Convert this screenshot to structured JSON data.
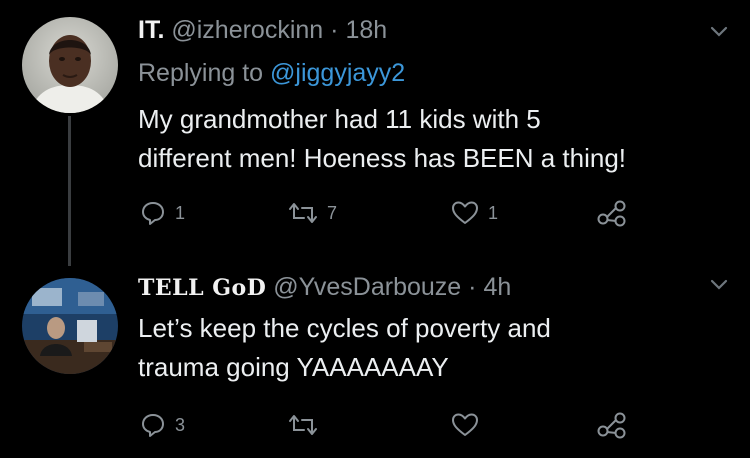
{
  "tweets": [
    {
      "display_name": "IT.",
      "handle": "@izherockinn",
      "separator": "·",
      "time": "18h",
      "reply_prefix": "Replying to",
      "reply_to": "@jiggyjayy2",
      "body_lines": [
        "My grandmother had 11 kids with 5",
        "different men! Hoeness has BEEN a thing!"
      ],
      "replies": "1",
      "retweets": "7",
      "likes": "1"
    },
    {
      "display_name": "TELL GoD",
      "handle": "@YvesDarbouze",
      "separator": "·",
      "time": "4h",
      "body_lines": [
        "Let’s keep the cycles of poverty and",
        "trauma going YAAAAAAAY"
      ],
      "replies": "3",
      "retweets": "",
      "likes": ""
    }
  ],
  "icons": {
    "reply": "reply-icon",
    "retweet": "retweet-icon",
    "like": "like-icon",
    "share": "share-icon",
    "more": "chevron-down-icon"
  },
  "colors": {
    "background": "#000000",
    "text": "#e7e9ea",
    "muted": "#8b9298",
    "link": "#3c97d9"
  }
}
